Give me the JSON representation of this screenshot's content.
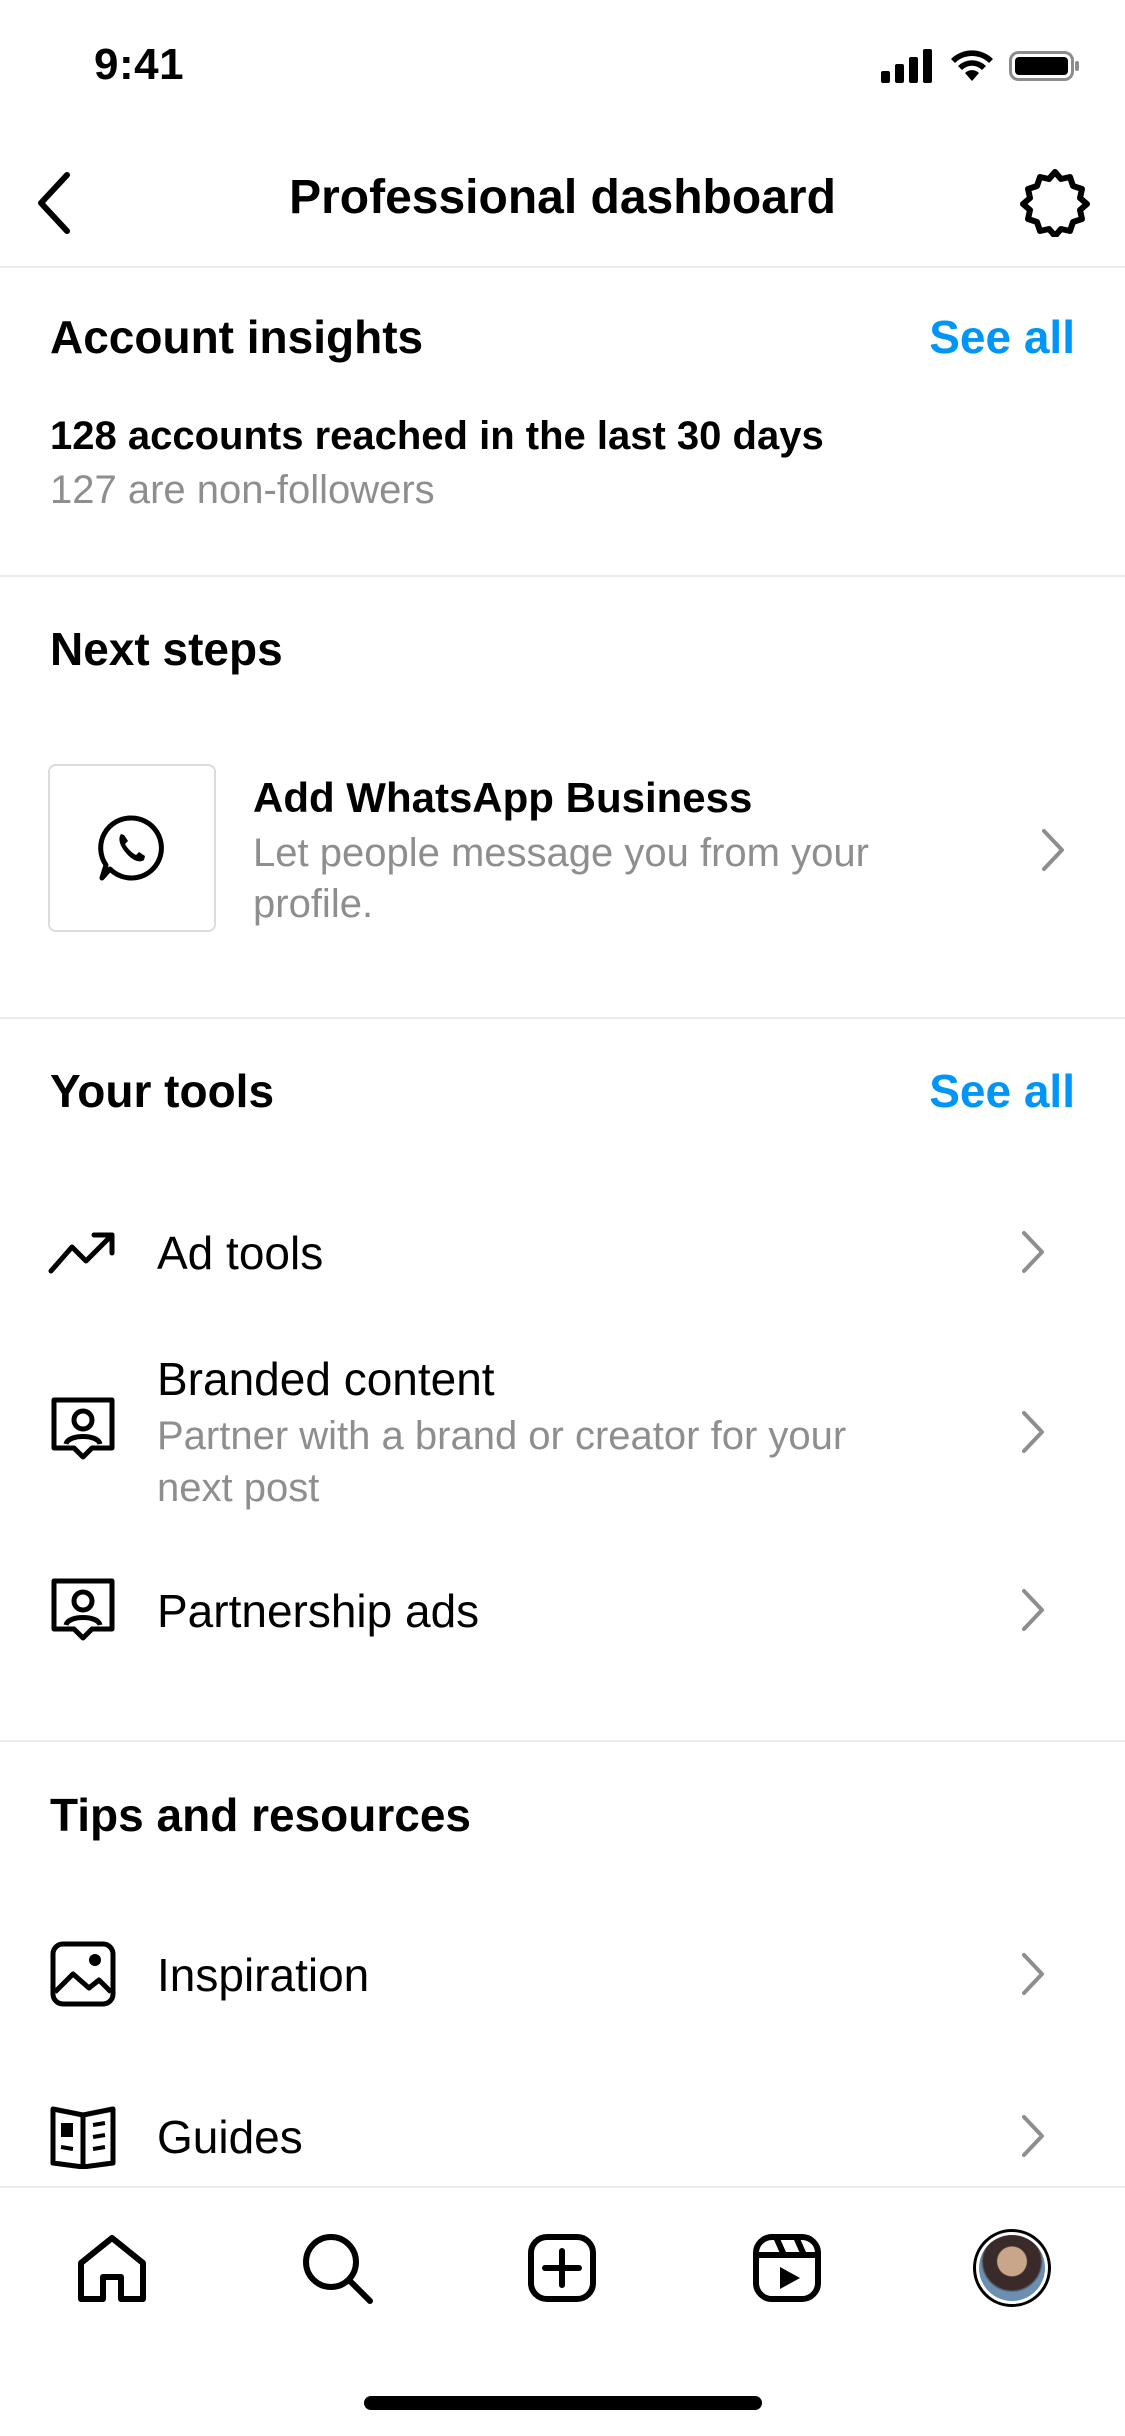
{
  "status_bar": {
    "time": "9:41"
  },
  "header": {
    "title": "Professional dashboard"
  },
  "account_insights": {
    "title": "Account insights",
    "see_all": "See all",
    "reach": "128 accounts reached in the last 30 days",
    "non_followers": "127 are non-followers"
  },
  "next_steps": {
    "title": "Next steps",
    "card": {
      "title": "Add WhatsApp Business",
      "subtitle_line1": "Let people message you from your",
      "subtitle_line2": "profile.",
      "icon": "whatsapp-icon"
    }
  },
  "your_tools": {
    "title": "Your tools",
    "see_all": "See all",
    "items": [
      {
        "label": "Ad tools",
        "icon": "trending-up-icon"
      },
      {
        "label": "Branded content",
        "subtitle_line1": "Partner with a brand or creator for your",
        "subtitle_line2": "next post",
        "icon": "branded-content-icon"
      },
      {
        "label": "Partnership ads",
        "icon": "partnership-ads-icon"
      }
    ]
  },
  "tips": {
    "title": "Tips and resources",
    "items": [
      {
        "label": "Inspiration",
        "icon": "image-icon"
      },
      {
        "label": "Guides",
        "icon": "book-icon"
      }
    ]
  },
  "bottom_nav": [
    "home-icon",
    "search-icon",
    "create-icon",
    "reels-icon",
    "profile-avatar"
  ],
  "colors": {
    "accent": "#0095f6",
    "muted": "#8e8e8e",
    "divider": "#ebebeb"
  }
}
